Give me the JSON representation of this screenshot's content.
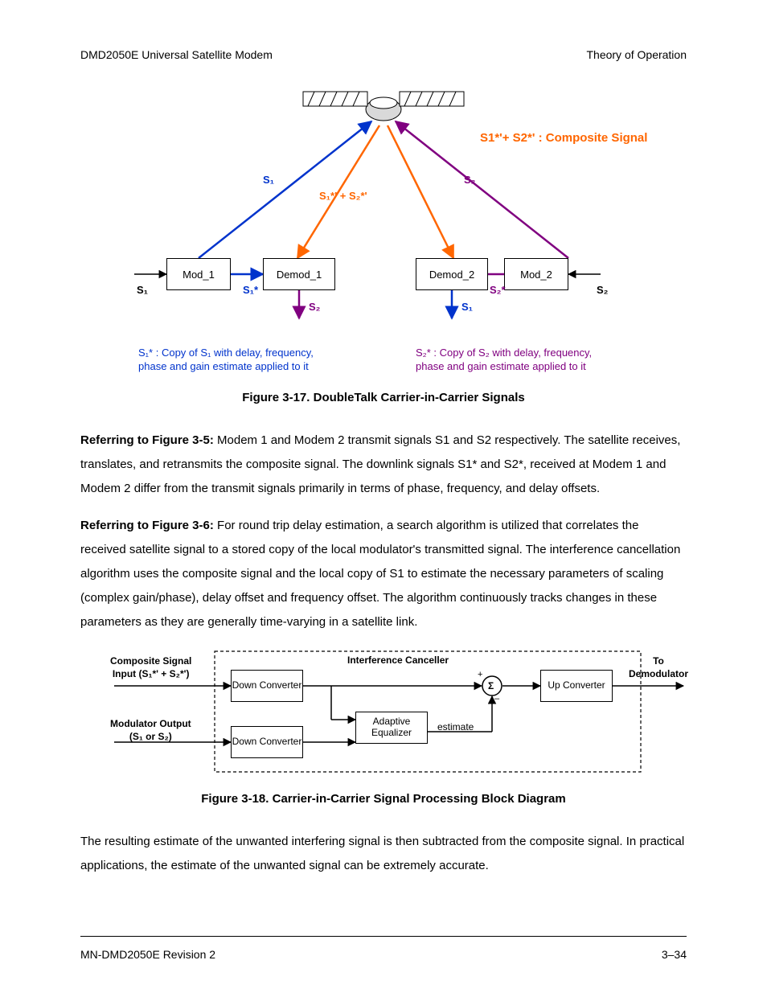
{
  "header": {
    "left": "DMD2050E Universal Satellite Modem",
    "right": "Theory of Operation"
  },
  "footer": {
    "left": "MN-DMD2050E   Revision 2",
    "right": "3–34"
  },
  "fig1": {
    "caption": "Figure 3-17. DoubleTalk Carrier-in-Carrier Signals",
    "composite": "S1*'+ S2*' : Composite Signal",
    "s1": "S₁",
    "s2": "S₂",
    "sum": "S₁*' + S₂*'",
    "mod1": "Mod_1",
    "demod1": "Demod_1",
    "demod2": "Demod_2",
    "mod2": "Mod_2",
    "s1_in": "S₁",
    "s2_in": "S₂",
    "s1star": "S₁*",
    "s2star": "S₂*",
    "s2_out": "S₂",
    "s1_out": "S₁",
    "note_left_a": "S₁* : Copy of S₁ with delay, frequency,",
    "note_left_b": "phase and gain estimate applied to it",
    "note_right_a": "S₂* : Copy of S₂ with delay, frequency,",
    "note_right_b": "phase and gain estimate applied to it"
  },
  "body": {
    "p1_lead": "Referring to Figure 3-5:",
    "p1_rest": " Modem 1 and Modem 2 transmit signals S1 and S2 respectively. The satellite receives, translates, and retransmits the composite signal. The downlink signals S1* and S2*, received at Modem 1 and Modem 2 differ from the transmit signals primarily in terms of phase, frequency, and delay offsets.",
    "p2_lead": "Referring to Figure 3-6:",
    "p2_rest": " For round trip delay estimation, a search algorithm is utilized that correlates the received satellite signal to a stored copy of the local modulator's transmitted signal. The interference cancellation algorithm uses the composite signal and the local copy of S1 to estimate the necessary parameters of scaling (complex gain/phase), delay offset and frequency offset. The algorithm continuously tracks changes in these parameters as they are generally time-varying in a satellite link.",
    "p3": "The resulting estimate of the unwanted interfering signal is then subtracted from the composite signal. In practical applications, the estimate of the unwanted signal can be extremely accurate."
  },
  "fig2": {
    "caption": "Figure 3-18. Carrier-in-Carrier Signal Processing Block Diagram",
    "comp_in_a": "Composite Signal",
    "comp_in_b": "Input (S₁*' + S₂*')",
    "mod_out_a": "Modulator Output",
    "mod_out_b": "(S₁ or S₂)",
    "dc": "Down Converter",
    "dc2": "Down Converter",
    "ic": "Interference Canceller",
    "ae": "Adaptive Equalizer",
    "uc": "Up Converter",
    "todemod_a": "To",
    "todemod_b": "Demodulator",
    "estimate": "estimate",
    "sigma": "Σ",
    "plus": "+",
    "minus": "–"
  }
}
